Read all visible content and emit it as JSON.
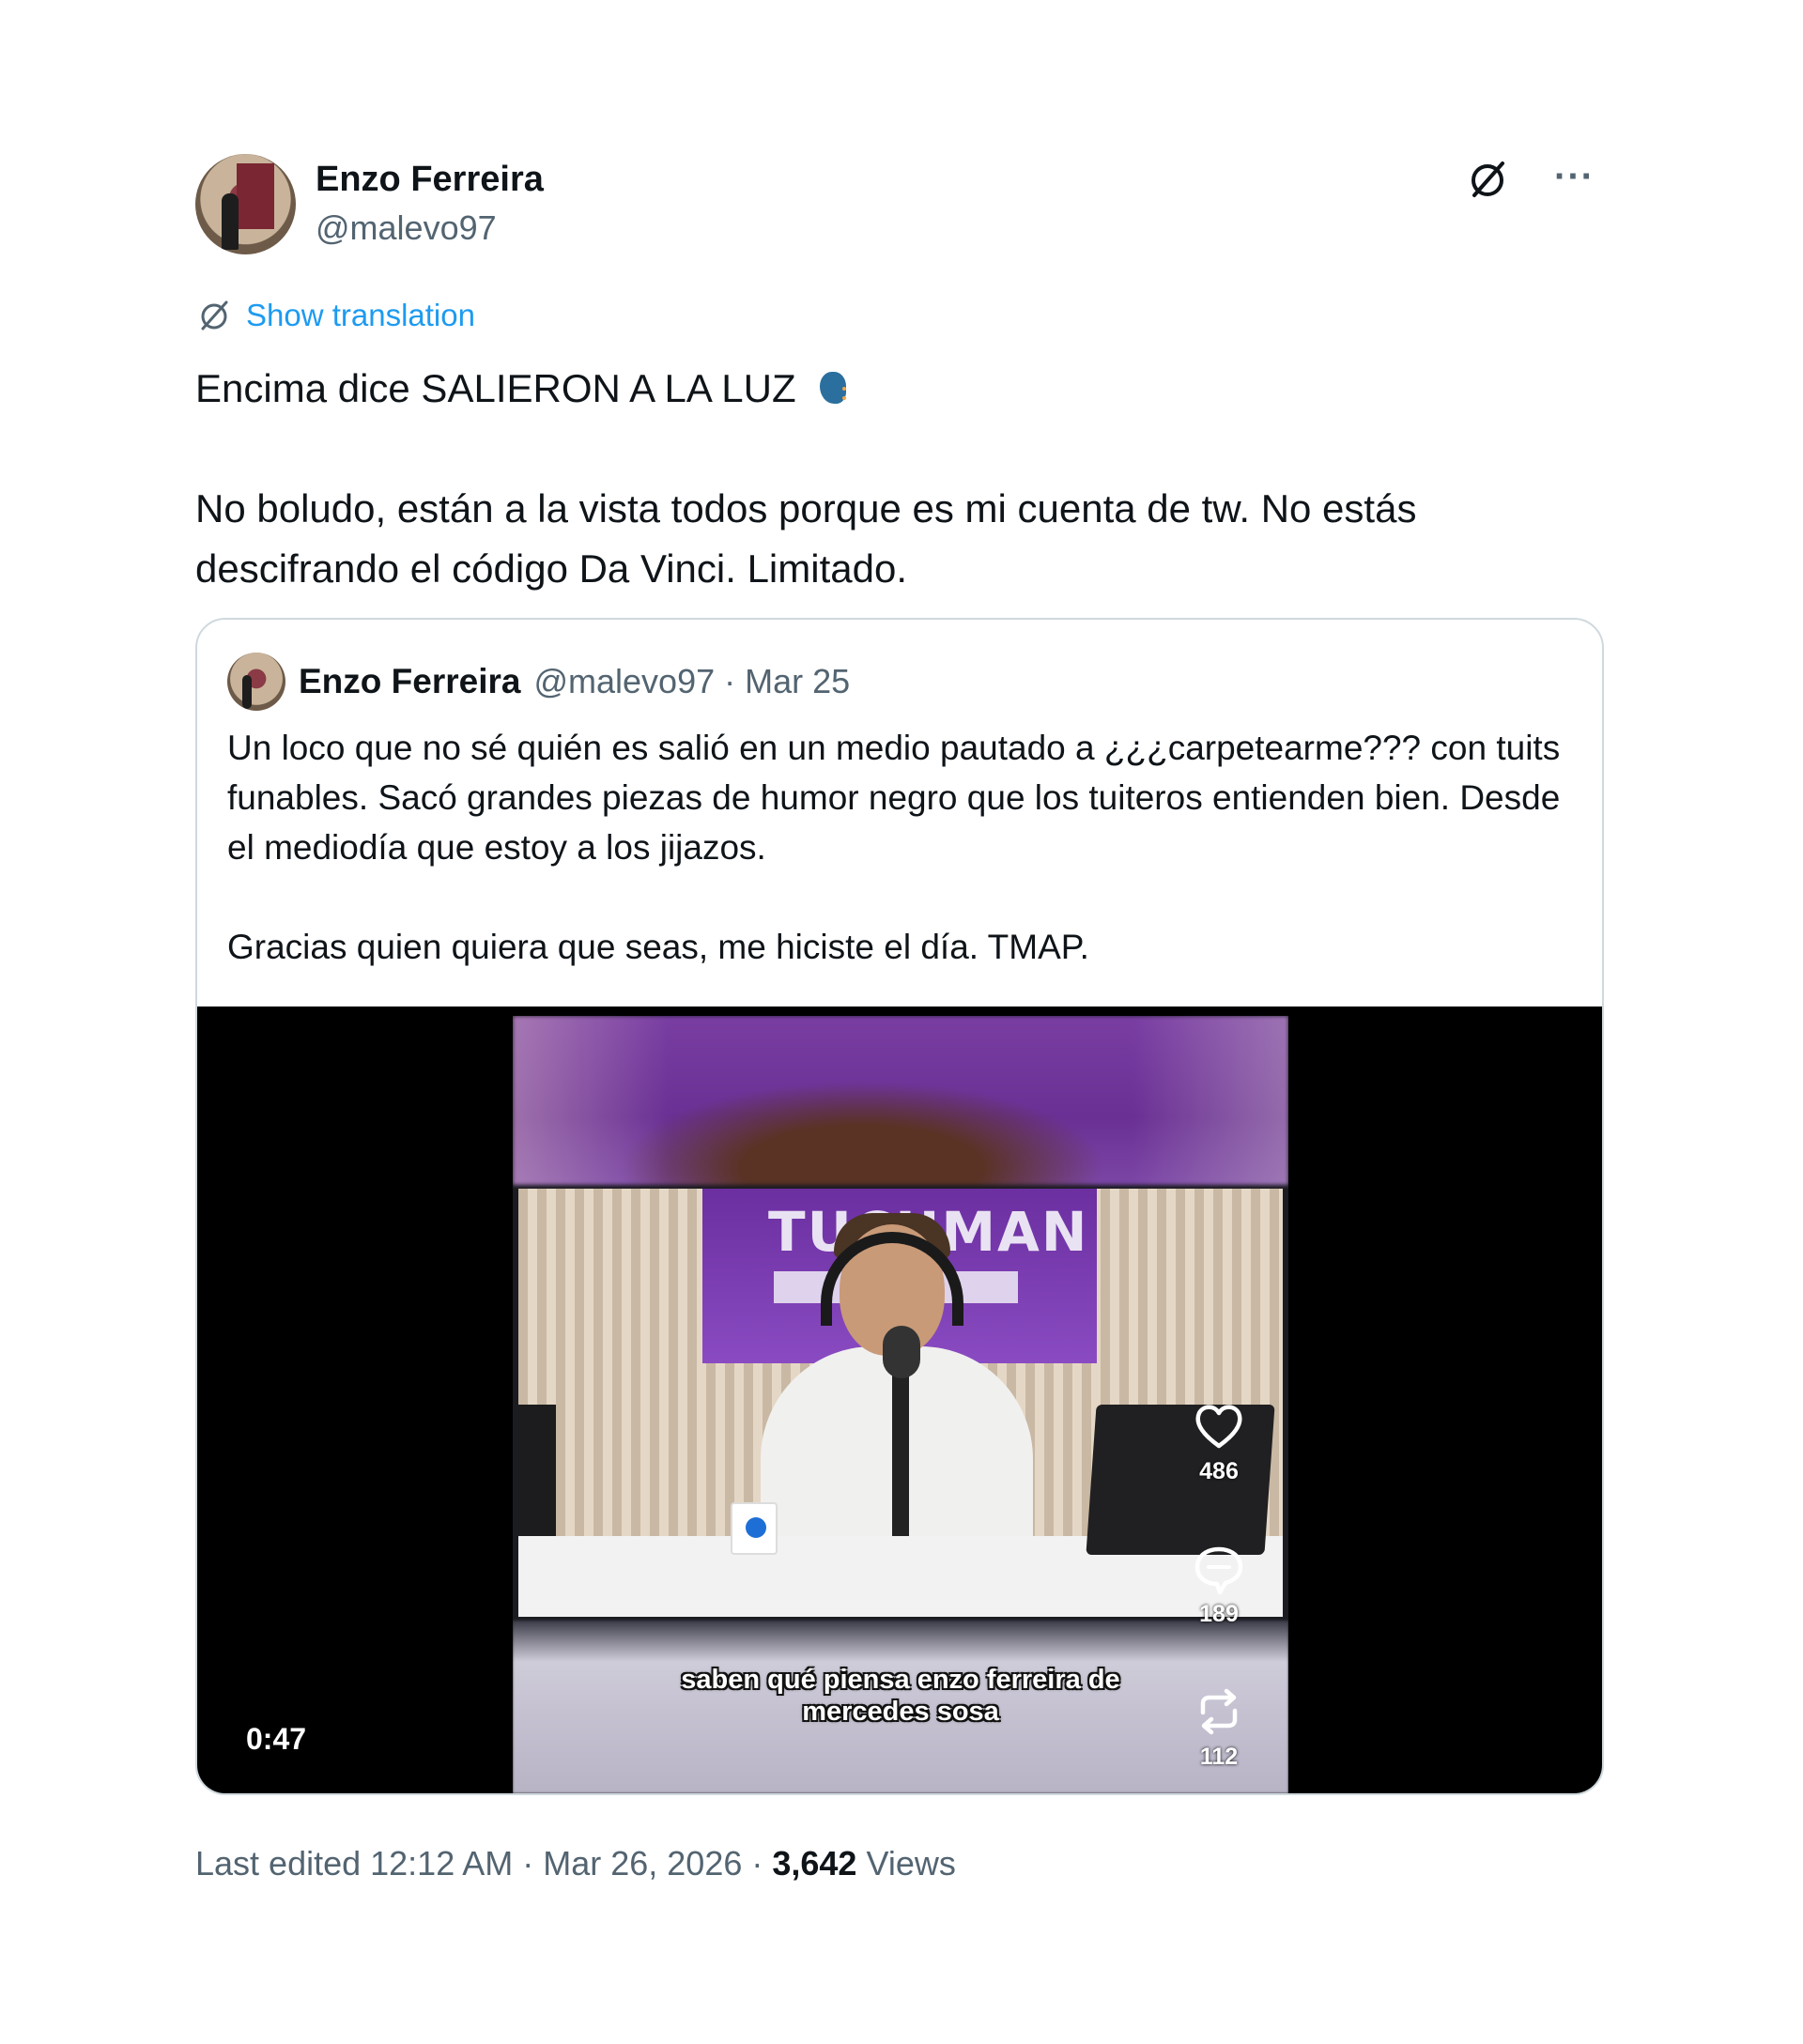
{
  "author": {
    "name": "Enzo Ferreira",
    "handle": "@malevo97"
  },
  "actions": {
    "grok_icon": "grok-icon",
    "more_label": "···"
  },
  "translation": {
    "label": "Show translation"
  },
  "tweet": {
    "line1": "Encima dice SALIERON A LA LUZ",
    "emoji": "speaking-head-emoji",
    "line2": "No boludo, están a la vista todos porque es mi cuenta de tw. No estás descifrando el código Da Vinci. Limitado."
  },
  "quoted": {
    "name": "Enzo Ferreira",
    "meta": "@malevo97 · Mar 25",
    "paragraph1": "Un loco que no sé quién es salió en un medio pautado a ¿¿¿carpetearme??? con tuits funables. Sacó grandes piezas de humor negro que los tuiteros entienden bien. Desde el mediodía que estoy a los jijazos.",
    "paragraph2": "Gracias quien quiera que seas, me hiciste el día. TMAP.",
    "video": {
      "duration": "0:47",
      "sign_text": "TUCUMAN",
      "caption_line1": "saben qué piensa enzo ferreira de",
      "caption_line2": "mercedes sosa",
      "likes": "486",
      "comments": "189",
      "reposts": "112"
    }
  },
  "footer": {
    "edited": "Last edited 12:12 AM · Mar 26, 2026 · ",
    "views_count": "3,642",
    "views_label": " Views"
  }
}
